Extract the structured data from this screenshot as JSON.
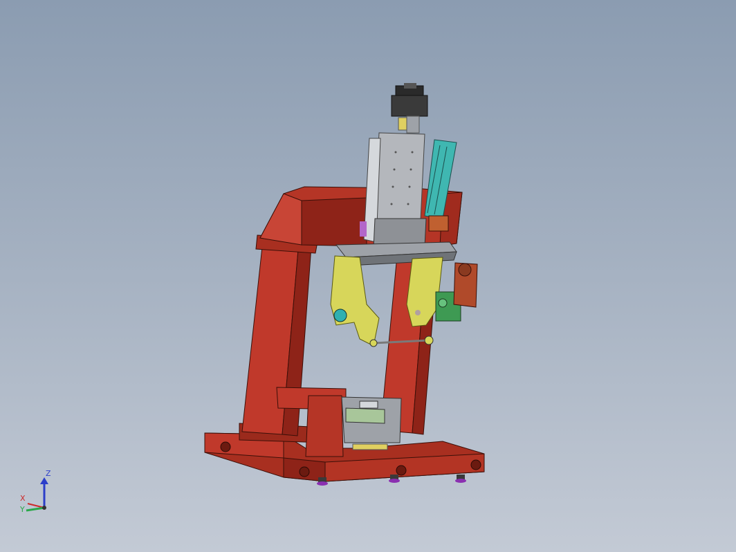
{
  "viewport": {
    "background_top": "#8b9cb1",
    "background_bottom": "#c3cad5"
  },
  "model": {
    "frame_color": "#c0392b",
    "frame_dark": "#8e2318",
    "gray_color": "#b4b7bc",
    "yellow_color": "#d7d65a",
    "cyan_color": "#3fb7b1",
    "green_color": "#3e9a53",
    "motor_color": "#2a2a2a"
  },
  "triad": {
    "z_label": "Z",
    "x_label": "X",
    "y_label": "Y",
    "z_color": "#2c3ec9",
    "x_color": "#cc2a2a",
    "y_color": "#2aa84a"
  }
}
